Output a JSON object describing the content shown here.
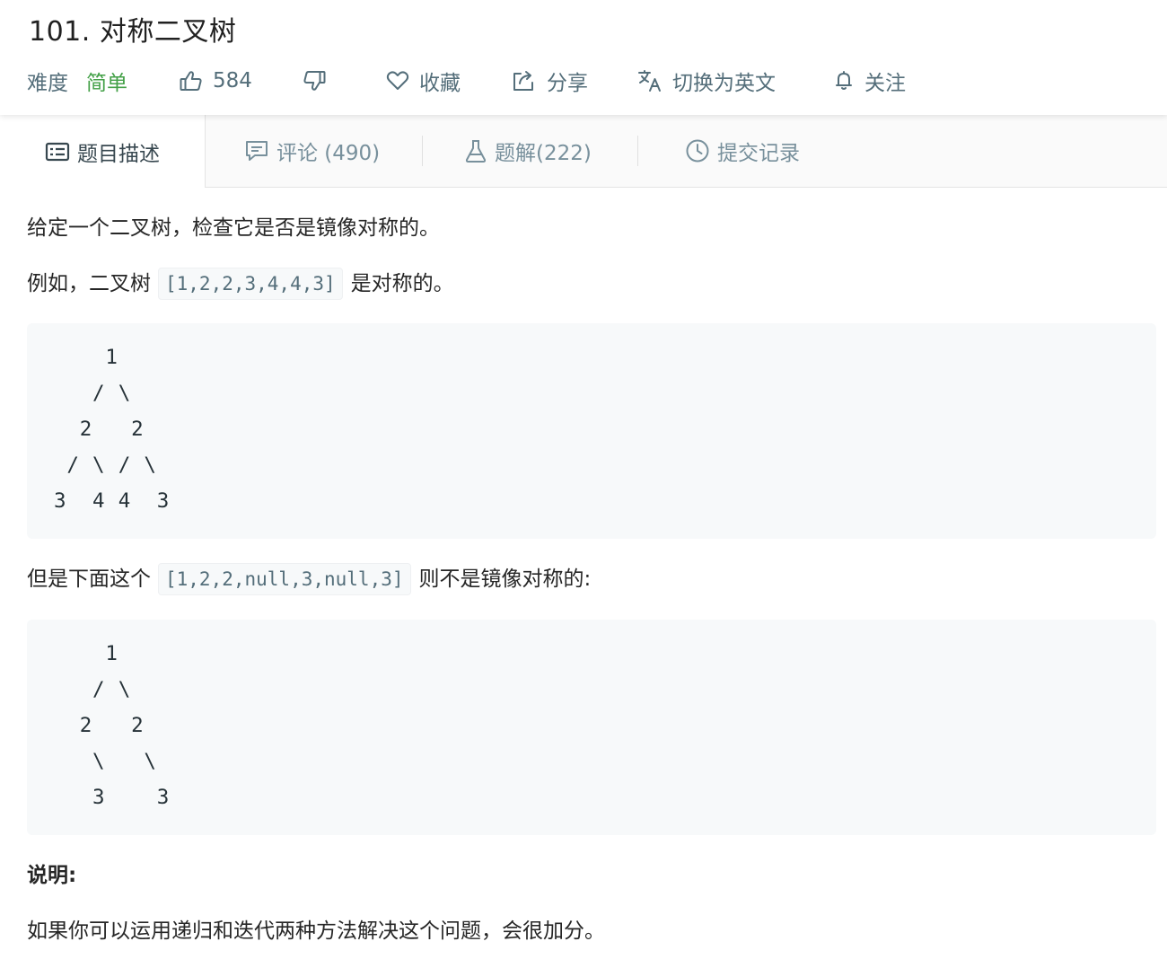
{
  "problem": {
    "title": "101. 对称二叉树",
    "difficulty_label": "难度",
    "difficulty_value": "简单",
    "likes": "584",
    "favorite_label": "收藏",
    "share_label": "分享",
    "translate_label": "切换为英文",
    "follow_label": "关注",
    "accent_color": "#43a047"
  },
  "tabs": [
    {
      "label": "题目描述",
      "icon": "description-icon",
      "active": true
    },
    {
      "label": "评论 (490)",
      "icon": "comment-icon",
      "active": false
    },
    {
      "label": "题解(222)",
      "icon": "flask-icon",
      "active": false
    },
    {
      "label": "提交记录",
      "icon": "clock-icon",
      "active": false
    }
  ],
  "description": {
    "intro": "给定一个二叉树，检查它是否是镜像对称的。",
    "example1_prefix": "例如，二叉树",
    "example1_code": "[1,2,2,3,4,4,3]",
    "example1_suffix": "是对称的。",
    "tree1": "    1\n   / \\\n  2   2\n / \\ / \\\n3  4 4  3",
    "example2_prefix": "但是下面这个",
    "example2_code": "[1,2,2,null,3,null,3]",
    "example2_suffix": "则不是镜像对称的:",
    "tree2": "    1\n   / \\\n  2   2\n   \\   \\\n   3    3",
    "note_heading": "说明:",
    "note_text": "如果你可以运用递归和迭代两种方法解决这个问题，会很加分。"
  }
}
